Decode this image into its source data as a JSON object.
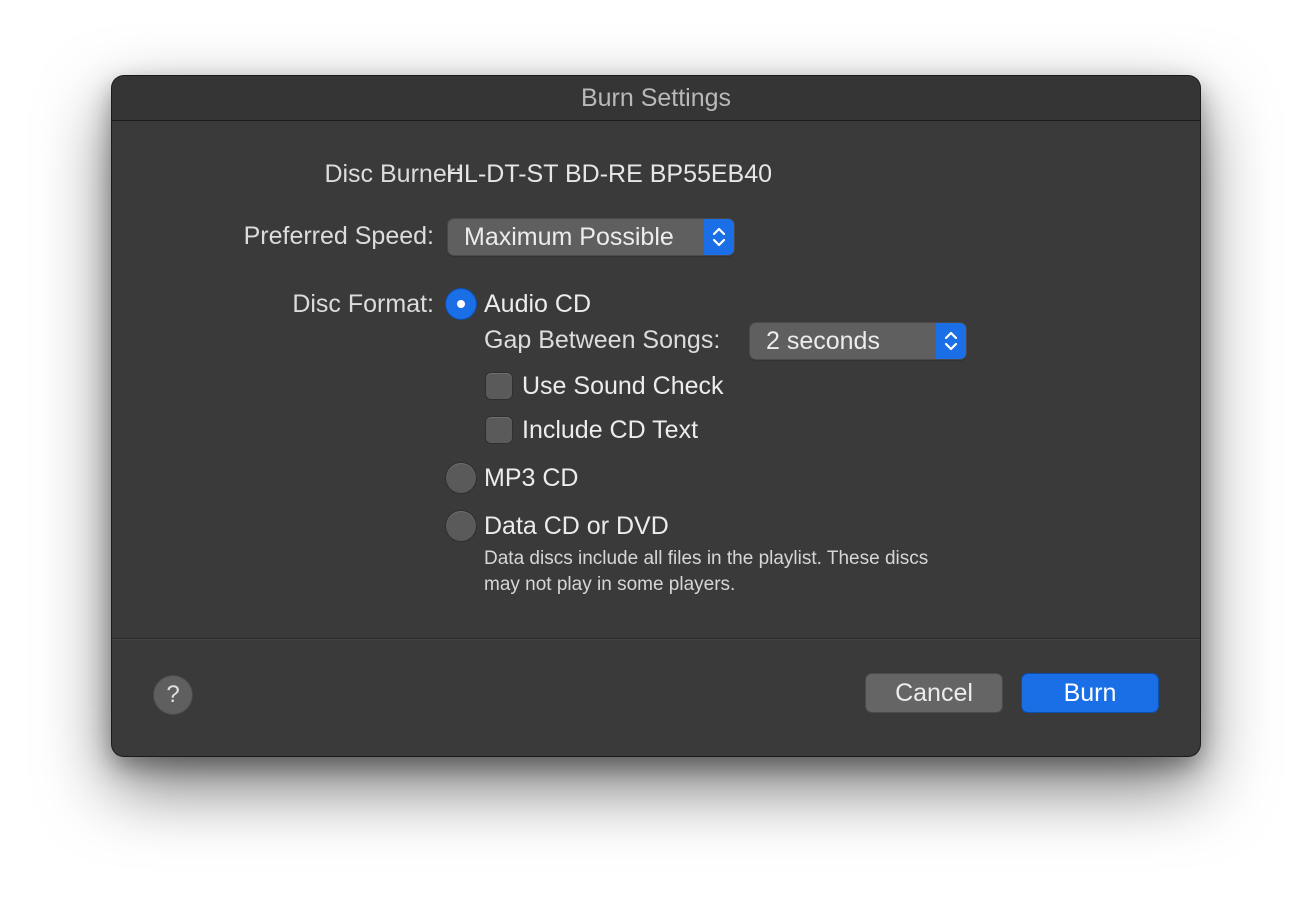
{
  "dialog": {
    "title": "Burn Settings"
  },
  "disc_burner": {
    "label": "Disc Burner:",
    "value": "HL-DT-ST BD-RE BP55EB40"
  },
  "preferred_speed": {
    "label": "Preferred Speed:",
    "selected": "Maximum Possible"
  },
  "disc_format": {
    "label": "Disc Format:",
    "selected_option": "Audio CD",
    "audio_cd": {
      "label": "Audio CD",
      "gap_label": "Gap Between Songs:",
      "gap_selected": "2 seconds",
      "sound_check_label": "Use Sound Check",
      "sound_check_checked": false,
      "cd_text_label": "Include CD Text",
      "cd_text_checked": false
    },
    "mp3_cd": {
      "label": "MP3 CD"
    },
    "data_cd": {
      "label": "Data CD or DVD",
      "note": "Data discs include all files in the playlist. These discs may not play in some players."
    }
  },
  "footer": {
    "help_label": "?",
    "cancel_label": "Cancel",
    "burn_label": "Burn"
  },
  "colors": {
    "accent": "#1a6ee6",
    "dialog_bg": "#3a3a3a"
  },
  "icons": {
    "popup_arrows": "chevron-up-down-icon",
    "help": "question-mark-icon"
  }
}
